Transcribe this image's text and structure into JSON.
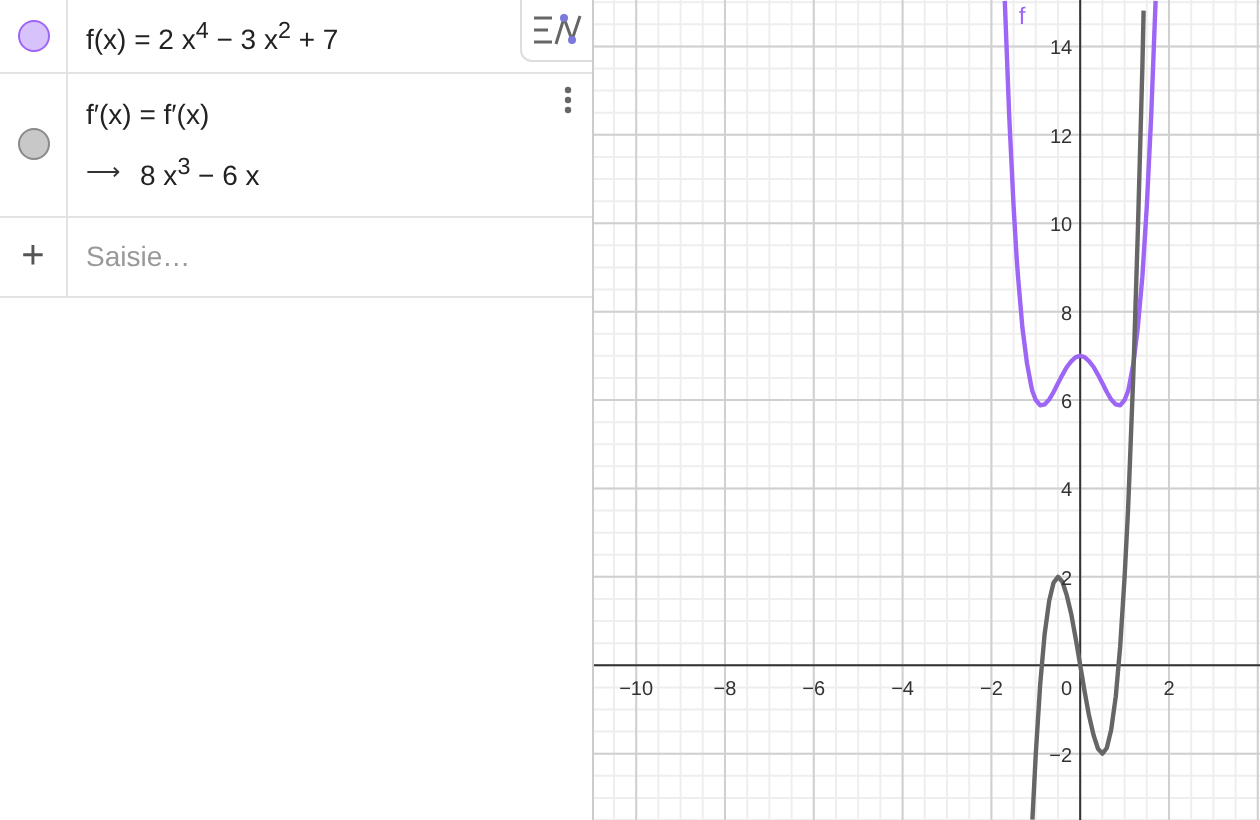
{
  "algebra": {
    "items": [
      {
        "kind": "definition",
        "color": "#9e66f5",
        "selected": false,
        "formula": "f(x) = 2 x$^{4}$ − 3 x$^{2}$ + 7"
      },
      {
        "kind": "derivative",
        "color": "#8a8a8a",
        "selected": true,
        "formula": "f′(x) = f′(x)",
        "output_arrow": "⟶",
        "output": "8 x$^{3}$ − 6 x"
      }
    ],
    "input": {
      "add_symbol": "+",
      "placeholder": "Saisie…"
    }
  },
  "graph": {
    "origin_label": "0",
    "chart_data": {
      "type": "line",
      "grid": true,
      "x": [
        -1.7,
        -1.6,
        -1.5,
        -1.43,
        -1.4,
        -1.3,
        -1.2,
        -1.1,
        -1.075,
        -1.0,
        -0.9,
        -0.8,
        -0.7,
        -0.6,
        -0.5,
        -0.4,
        -0.3,
        -0.2,
        -0.1,
        0,
        0.1,
        0.2,
        0.3,
        0.4,
        0.5,
        0.6,
        0.7,
        0.8,
        0.9,
        1.0,
        1.075,
        1.1,
        1.2,
        1.3,
        1.4,
        1.43,
        1.5,
        1.6,
        1.7
      ],
      "series": [
        {
          "name": "f",
          "color": "#9e66f5",
          "values": [
            15.03,
            12.43,
            10.38,
            9.23,
            8.8,
            7.64,
            6.83,
            6.3,
            6.2,
            6,
            5.88,
            5.9,
            6.01,
            6.18,
            6.38,
            6.57,
            6.75,
            6.88,
            6.97,
            7,
            6.97,
            6.88,
            6.75,
            6.57,
            6.38,
            6.18,
            6.01,
            5.9,
            5.88,
            6,
            6.2,
            6.3,
            6.83,
            7.64,
            8.8,
            9.23,
            10.38,
            12.43,
            15.03
          ]
        },
        {
          "color": "#666666",
          "values": [
            null,
            null,
            null,
            null,
            null,
            null,
            null,
            null,
            -3.49,
            -2,
            -0.43,
            0.7,
            1.46,
            1.87,
            2,
            1.89,
            1.58,
            1.14,
            0.59,
            0,
            -0.59,
            -1.14,
            -1.58,
            -1.89,
            -2,
            -1.87,
            -1.46,
            -0.7,
            0.43,
            2,
            3.49,
            4.05,
            6.62,
            9.78,
            13.55,
            14.81,
            null,
            null,
            null
          ]
        }
      ],
      "xlim": [
        -10.95,
        4.05
      ],
      "ylim": [
        -3.5,
        15.05
      ],
      "xticks": [
        {
          "value": -10,
          "label": "−10"
        },
        {
          "value": -8,
          "label": "−8"
        },
        {
          "value": -6,
          "label": "−6"
        },
        {
          "value": -4,
          "label": "−4"
        },
        {
          "value": -2,
          "label": "−2"
        },
        {
          "value": 2,
          "label": "2"
        }
      ],
      "yticks": [
        {
          "value": -2,
          "label": "−2"
        },
        {
          "value": 2,
          "label": "2"
        },
        {
          "value": 4,
          "label": "4"
        },
        {
          "value": 6,
          "label": "6"
        },
        {
          "value": 8,
          "label": "8"
        },
        {
          "value": 10,
          "label": "10"
        },
        {
          "value": 12,
          "label": "12"
        },
        {
          "value": 14,
          "label": "14"
        }
      ]
    }
  }
}
